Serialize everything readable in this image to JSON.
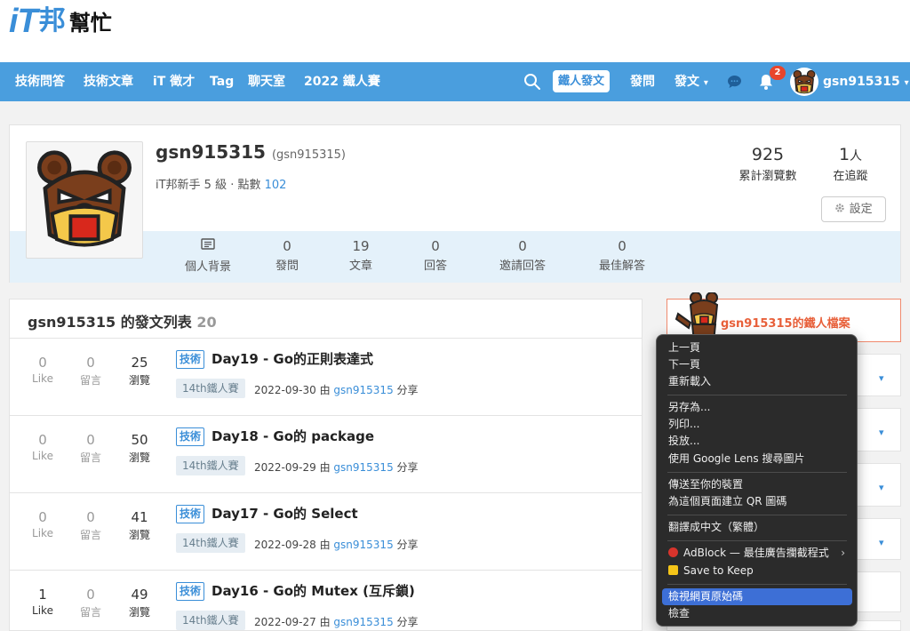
{
  "logo": {
    "it": "iT",
    "bang": "邦",
    "help": "幫忙"
  },
  "nav": {
    "items": [
      "技術問答",
      "技術文章",
      "iT 徵才",
      "Tag",
      "聊天室",
      "2022 鐵人賽"
    ],
    "ironman_post": "鐵人發文",
    "ask": "發問",
    "post": "發文",
    "dropdown_caret": "▾",
    "notification_count": "2",
    "username": "gsn915315"
  },
  "profile": {
    "name": "gsn915315",
    "alias": "(gsn915315)",
    "level_text": "iT邦新手 5 級 · 點數",
    "points": "102",
    "total_views": "925",
    "total_views_label": "累計瀏覽數",
    "followers": "1",
    "followers_unit": "人",
    "followers_label": "在追蹤",
    "settings_label": "設定",
    "stats": [
      {
        "num": "",
        "label": "個人背景"
      },
      {
        "num": "0",
        "label": "發問"
      },
      {
        "num": "19",
        "label": "文章"
      },
      {
        "num": "0",
        "label": "回答"
      },
      {
        "num": "0",
        "label": "邀請回答"
      },
      {
        "num": "0",
        "label": "最佳解答"
      }
    ]
  },
  "posts": {
    "title": "gsn915315 的發文列表",
    "count": "20",
    "like_label": "Like",
    "comment_label": "留言",
    "view_label": "瀏覽",
    "tech_label": "技術",
    "by": "由",
    "share": "分享",
    "rows": [
      {
        "likes": "0",
        "comments": "0",
        "views": "25",
        "title": "Day19 - Go的正則表達式",
        "tag": "14th鐵人賽",
        "date": "2022-09-30",
        "author": "gsn915315"
      },
      {
        "likes": "0",
        "comments": "0",
        "views": "50",
        "title": "Day18 - Go的 package",
        "tag": "14th鐵人賽",
        "date": "2022-09-29",
        "author": "gsn915315"
      },
      {
        "likes": "0",
        "comments": "0",
        "views": "41",
        "title": "Day17 - Go的 Select",
        "tag": "14th鐵人賽",
        "date": "2022-09-28",
        "author": "gsn915315"
      },
      {
        "likes": "1",
        "comments": "0",
        "views": "49",
        "title": "Day16 - Go的 Mutex (互斥鎖)",
        "tag": "14th鐵人賽",
        "date": "2022-09-27",
        "author": "gsn915315"
      }
    ]
  },
  "sidebar": {
    "ironman_file": "gsn915315的鐵人檔案"
  },
  "context_menu": {
    "items": [
      "上一頁",
      "下一頁",
      "重新載入",
      "另存為...",
      "列印...",
      "投放...",
      "使用 Google Lens 搜尋圖片",
      "傳送至你的裝置",
      "為這個頁面建立 QR 圖碼",
      "翻譯成中文（繁體）",
      "AdBlock — 最佳廣告攔截程式",
      "Save to Keep",
      "檢視網頁原始碼",
      "檢查"
    ],
    "submenu_arrow": "›"
  },
  "colors": {
    "brand": "#4a9ede",
    "accent": "#3a8ed8",
    "ironman": "#e8603a",
    "menu_highlight": "#3d6fd6"
  }
}
